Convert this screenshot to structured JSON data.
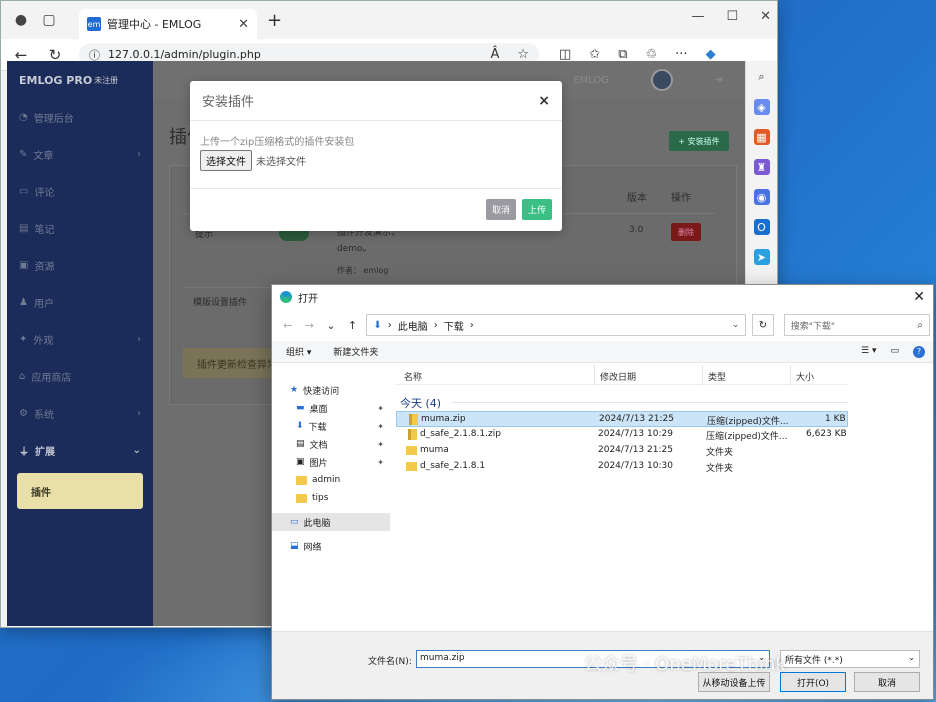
{
  "browser": {
    "tab_title": "管理中心 - EMLOG",
    "tab_favicon": "em",
    "url": "127.0.0.1/admin/plugin.php",
    "font_size_label": "Â"
  },
  "admin": {
    "brand": "EMLOG PRO",
    "brand_tag": "未注册",
    "top_text": "EMLOG",
    "page_heading": "插件",
    "install_button": "+ 安装插件",
    "sidebar": [
      {
        "label": "管理后台",
        "icon": "dashboard-icon",
        "arrow": false
      },
      {
        "label": "文章",
        "icon": "pen-icon",
        "arrow": true
      },
      {
        "label": "评论",
        "icon": "comment-icon",
        "arrow": false
      },
      {
        "label": "笔记",
        "icon": "note-icon",
        "arrow": false
      },
      {
        "label": "资源",
        "icon": "image-icon",
        "arrow": false
      },
      {
        "label": "用户",
        "icon": "user-icon",
        "arrow": false
      },
      {
        "label": "外观",
        "icon": "appearance-icon",
        "arrow": true
      },
      {
        "label": "应用商店",
        "icon": "store-icon",
        "arrow": false
      },
      {
        "label": "系统",
        "icon": "gear-icon",
        "arrow": true
      },
      {
        "label": "扩展",
        "icon": "plug-icon",
        "arrow": true
      },
      {
        "label": "插件",
        "icon": "",
        "arrow": false
      }
    ],
    "table_headers": {
      "version": "版本",
      "action": "操作"
    },
    "row1": {
      "name_fragment": "提示",
      "desc_line1": "插件开发演示，",
      "desc_line2": "demo。",
      "author_label": "作者：",
      "author": "emlog",
      "version": "3.0",
      "delete": "删除"
    },
    "row2": {
      "name": "模版设置插件"
    },
    "notice": "插件更新检查异常"
  },
  "modal": {
    "title": "安装插件",
    "close": "×",
    "hint": "上传一个zip压缩格式的插件安装包",
    "choose_file": "选择文件",
    "no_file": "未选择文件",
    "cancel": "取消",
    "upload": "上传"
  },
  "dialog": {
    "title": "打开",
    "path": [
      "此电脑",
      "下载"
    ],
    "search_placeholder": "搜索\"下载\"",
    "organize": "组织 ▾",
    "new_folder": "新建文件夹",
    "nav": [
      {
        "label": "快速访问",
        "kind": "star"
      },
      {
        "label": "桌面",
        "kind": "desktop",
        "pin": true
      },
      {
        "label": "下载",
        "kind": "download",
        "pin": true
      },
      {
        "label": "文档",
        "kind": "doc",
        "pin": true
      },
      {
        "label": "图片",
        "kind": "pic",
        "pin": true
      },
      {
        "label": "admin",
        "kind": "folder"
      },
      {
        "label": "tips",
        "kind": "folder"
      },
      {
        "label": "此电脑",
        "kind": "pc"
      },
      {
        "label": "网络",
        "kind": "net"
      }
    ],
    "columns": {
      "name": "名称",
      "date": "修改日期",
      "type": "类型",
      "size": "大小"
    },
    "group": "今天 (4)",
    "files": [
      {
        "name": "muma.zip",
        "date": "2024/7/13 21:25",
        "type": "压缩(zipped)文件...",
        "size": "1 KB",
        "kind": "zip",
        "selected": true
      },
      {
        "name": "d_safe_2.1.8.1.zip",
        "date": "2024/7/13 10:29",
        "type": "压缩(zipped)文件...",
        "size": "6,623 KB",
        "kind": "zip",
        "selected": false
      },
      {
        "name": "muma",
        "date": "2024/7/13 21:25",
        "type": "文件夹",
        "size": "",
        "kind": "folder",
        "selected": false
      },
      {
        "name": "d_safe_2.1.8.1",
        "date": "2024/7/13 10:30",
        "type": "文件夹",
        "size": "",
        "kind": "folder",
        "selected": false
      }
    ],
    "filename_label": "文件名(N):",
    "filename_value": "muma.zip",
    "filetype": "所有文件 (*.*)",
    "btn_mobile": "从移动设备上传",
    "btn_open": "打开(O)",
    "btn_cancel": "取消"
  },
  "watermark": "公众号 · OneMoreThink"
}
